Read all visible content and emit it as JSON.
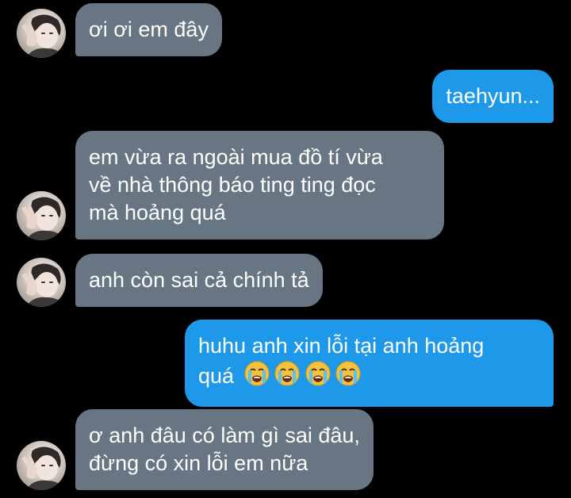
{
  "conversation": {
    "messages": [
      {
        "side": "incoming",
        "text": "ơi ơi em đây"
      },
      {
        "side": "outgoing",
        "text": "taehyun..."
      },
      {
        "side": "incoming",
        "lines": [
          "em vừa ra ngoài mua đồ tí vừa",
          "về nhà thông báo ting ting đọc",
          "mà hoảng quá"
        ]
      },
      {
        "side": "incoming",
        "text": "anh còn sai cả chính tả"
      },
      {
        "side": "outgoing",
        "lines": [
          "huhu anh xin lỗi tại anh hoảng",
          "quá"
        ],
        "emoji": [
          "loudly-crying-face",
          "loudly-crying-face",
          "loudly-crying-face",
          "loudly-crying-face"
        ]
      },
      {
        "side": "incoming",
        "lines": [
          "ơ anh đâu có làm gì sai đâu,",
          "đừng có xin lỗi em nữa"
        ]
      }
    ]
  },
  "colors": {
    "background": "#000000",
    "incoming_bubble": "#687683",
    "outgoing_bubble": "#1e99ea",
    "text": "#ffffff"
  }
}
